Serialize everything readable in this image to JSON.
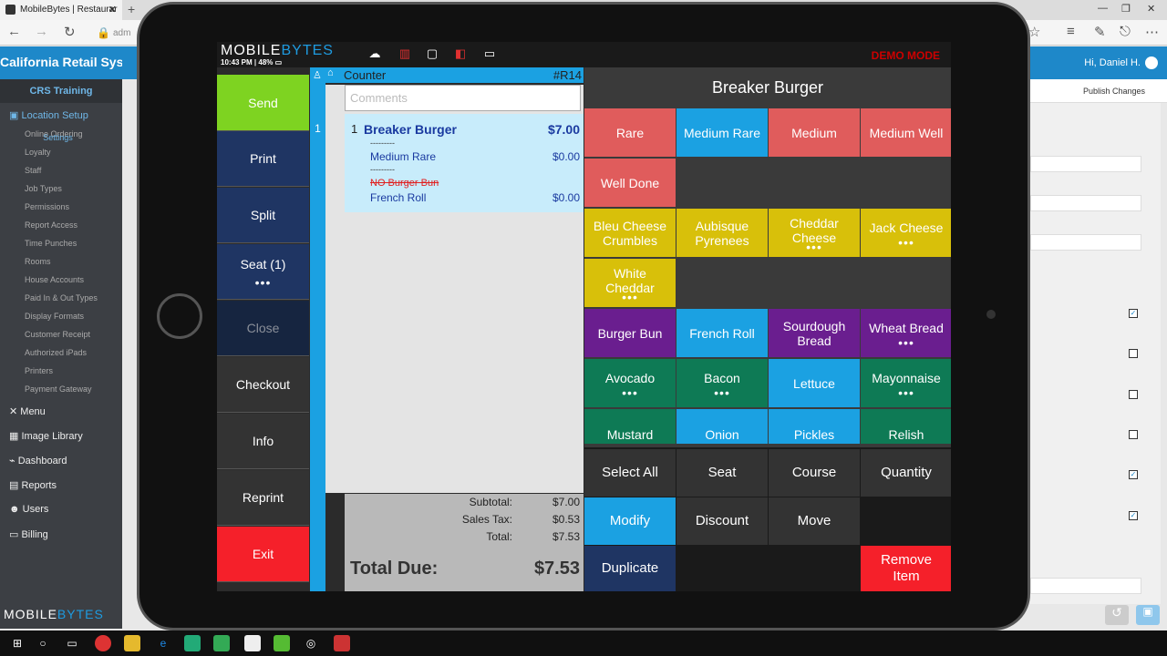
{
  "browser": {
    "tab_title": "MobileBytes | Restaurar",
    "address_text": "adm"
  },
  "webapp": {
    "title": "California Retail Syst...",
    "user_greeting": "Hi, Daniel H.",
    "sidebar_header": "CRS Training",
    "location_setup": "Location Setup",
    "sub_items": [
      "Settings",
      "Online Ordering",
      "Loyalty",
      "Staff",
      "Job Types",
      "Permissions",
      "Report Access",
      "Time Punches",
      "Rooms",
      "House Accounts",
      "Paid In & Out Types",
      "Display Formats",
      "Customer Receipt",
      "Authorized iPads",
      "Printers",
      "Payment Gateway"
    ],
    "main_items": [
      "Menu",
      "Image Library",
      "Dashboard",
      "Reports",
      "Users",
      "Billing"
    ],
    "logo_a": "MOBILE",
    "logo_b": "BYTES",
    "publish_changes": "Publish Changes"
  },
  "pos": {
    "logo_a": "MOBILE",
    "logo_b": "BYTES",
    "status_time": "10:43 PM",
    "status_battery": "48%",
    "demo_mode": "DEMO MODE",
    "left_buttons": {
      "send": "Send",
      "print": "Print",
      "split": "Split",
      "seat": "Seat (1)",
      "close": "Close",
      "checkout": "Checkout",
      "info": "Info",
      "reprint": "Reprint",
      "exit": "Exit"
    },
    "seat_number": "1",
    "order": {
      "counter": "Counter",
      "ticket": "#R14",
      "comments_placeholder": "Comments",
      "item_qty": "1",
      "item_name": "Breaker Burger",
      "item_price": "$7.00",
      "separator": "---------",
      "mod1_name": "Medium Rare",
      "mod1_price": "$0.00",
      "mod2_name": "NO Burger Bun",
      "mod3_name": "French Roll",
      "mod3_price": "$0.00"
    },
    "totals": {
      "subtotal_label": "Subtotal:",
      "subtotal": "$7.00",
      "tax_label": "Sales Tax:",
      "tax": "$0.53",
      "total_label": "Total:",
      "total": "$7.53",
      "due_label": "Total Due:",
      "due": "$7.53"
    },
    "item_title": "Breaker Burger",
    "modifiers": {
      "rare": "Rare",
      "medium_rare": "Medium Rare",
      "medium": "Medium",
      "medium_well": "Medium Well",
      "well_done": "Well Done",
      "bleu_cheese_a": "Bleu Cheese",
      "bleu_cheese_b": "Crumbles",
      "aubisque_a": "Aubisque",
      "aubisque_b": "Pyrenees",
      "cheddar_a": "Cheddar",
      "cheddar_b": "Cheese",
      "jack_cheese": "Jack Cheese",
      "white_cheddar_a": "White",
      "white_cheddar_b": "Cheddar",
      "burger_bun": "Burger Bun",
      "french_roll": "French Roll",
      "sourdough_a": "Sourdough",
      "sourdough_b": "Bread",
      "wheat_bread": "Wheat Bread",
      "avocado": "Avocado",
      "bacon": "Bacon",
      "lettuce": "Lettuce",
      "mayonnaise": "Mayonnaise",
      "mustard": "Mustard",
      "onion": "Onion",
      "pickles": "Pickles",
      "relish": "Relish"
    },
    "actions": {
      "select_all": "Select All",
      "seat": "Seat",
      "course": "Course",
      "quantity": "Quantity",
      "modify": "Modify",
      "discount": "Discount",
      "move": "Move",
      "duplicate": "Duplicate",
      "remove_a": "Remove",
      "remove_b": "Item"
    },
    "more_dots": "•••",
    "colors": {
      "red": "#e05c5c",
      "blue": "#1ba1e2",
      "yellow": "#d8c00a",
      "purple": "#6a1e8f",
      "green": "#0e7a55",
      "send": "#7ed321",
      "exit": "#f5202a",
      "navy": "#1f3563"
    }
  }
}
